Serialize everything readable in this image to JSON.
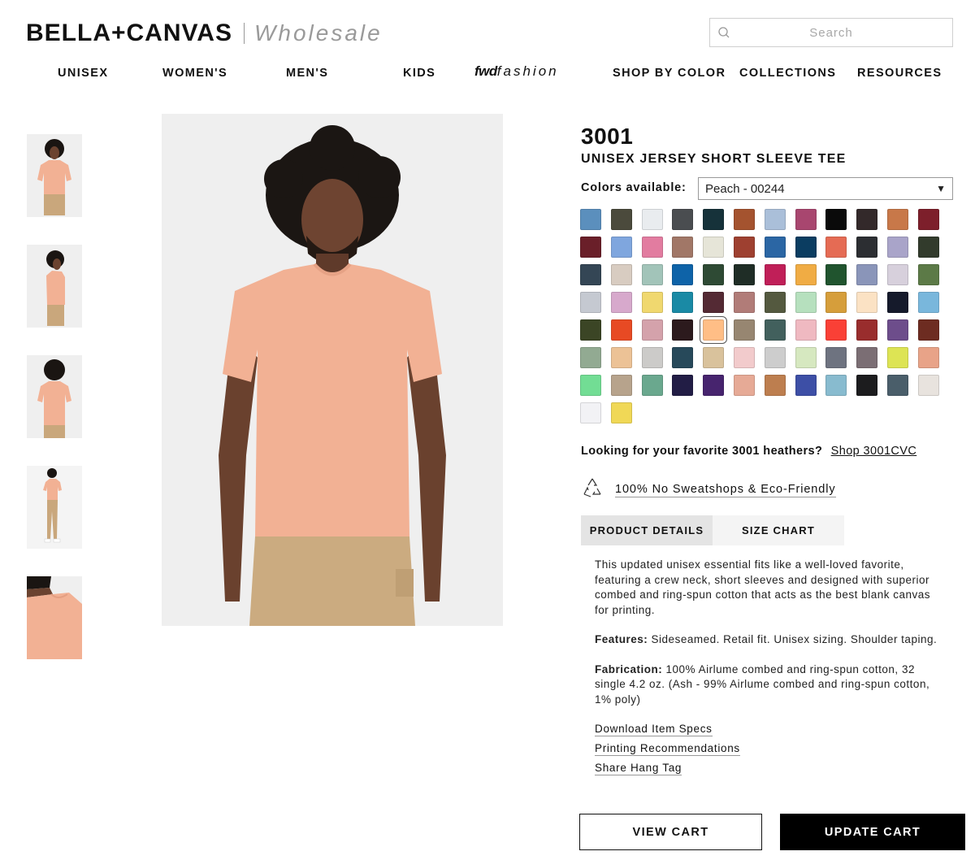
{
  "header": {
    "logo_main": "BELLA+CANVAS",
    "logo_sub": "Wholesale",
    "search_placeholder": "Search"
  },
  "nav": {
    "items": [
      "UNISEX",
      "WOMEN'S",
      "MEN'S",
      "KIDS",
      "SHOP BY COLOR",
      "COLLECTIONS",
      "RESOURCES"
    ],
    "fwd_logo": {
      "a": "fwd",
      "b": "fashion"
    }
  },
  "product": {
    "sku": "3001",
    "name": "UNISEX JERSEY SHORT SLEEVE TEE",
    "colors_label": "Colors available:",
    "selected_color": "Peach - 00244",
    "swatches": [
      "#5b8fbd",
      "#4b4a3c",
      "#e9ecef",
      "#4a4d50",
      "#16323a",
      "#a4532f",
      "#aabfd9",
      "#a8466f",
      "#0a0a0a",
      "#33292a",
      "#c87849",
      "#7d1f2b",
      "#6a1f29",
      "#7fa6de",
      "#e27ca0",
      "#a17767",
      "#e6e5d8",
      "#9e4030",
      "#2b66a4",
      "#0b3d61",
      "#e56b54",
      "#2c2e32",
      "#a9a4c9",
      "#323b2c",
      "#344655",
      "#d8ccc1",
      "#a2c4b9",
      "#0e63a8",
      "#2e4a34",
      "#1f2d26",
      "#c01f58",
      "#f0ac44",
      "#20542e",
      "#8a95b9",
      "#d7d0dc",
      "#5c7a47",
      "#c5c9d1",
      "#d7a9cc",
      "#f0d86f",
      "#1a8aa5",
      "#542a34",
      "#b17c78",
      "#54593f",
      "#b6e0be",
      "#d69e3b",
      "#fbe2c4",
      "#151a2b",
      "#79b7dc",
      "#3b4525",
      "#e74a24",
      "#d4a2ab",
      "#2c1a1d",
      "#ffbe86",
      "#978671",
      "#42605d",
      "#efb9c1",
      "#fa4036",
      "#992d2d",
      "#6d4d8b",
      "#6d2c21",
      "#92aa92",
      "#ecc296",
      "#cccbc9",
      "#27495a",
      "#d9c29c",
      "#f2cbcc",
      "#cdcdcd",
      "#d6e8c0",
      "#6e7380",
      "#7b6e74",
      "#dde454",
      "#e8a388",
      "#72dd94",
      "#b7a38c",
      "#6aa88e",
      "#221d45",
      "#47246e",
      "#e6aa96",
      "#bd7e4f",
      "#3d4fa6",
      "#88bbcf",
      "#1c1c1e",
      "#4a5e6a",
      "#e8e3de",
      "#f2f2f5",
      "#f0d856"
    ],
    "selected_index": 52,
    "heathers_text": "Looking for your favorite 3001 heathers?",
    "heathers_link": "Shop 3001CVC",
    "eco_link": "100% No Sweatshops & Eco-Friendly",
    "tabs": [
      "PRODUCT DETAILS",
      "SIZE CHART"
    ],
    "description": "This updated unisex essential fits like a well-loved favorite, featuring a crew neck, short sleeves and designed with superior combed and ring-spun cotton that acts as the best blank canvas for printing.",
    "features_label": "Features:",
    "features": "Sideseamed. Retail fit. Unisex sizing. Shoulder taping.",
    "fabrication_label": "Fabrication:",
    "fabrication": "100% Airlume combed and ring-spun cotton, 32 single 4.2 oz. (Ash - 99% Airlume combed and ring-spun cotton, 1% poly)",
    "links": [
      "Download Item Specs",
      "Printing Recommendations",
      "Share Hang Tag"
    ],
    "view_cart": "VIEW CART",
    "update_cart": "UPDATE CART"
  }
}
